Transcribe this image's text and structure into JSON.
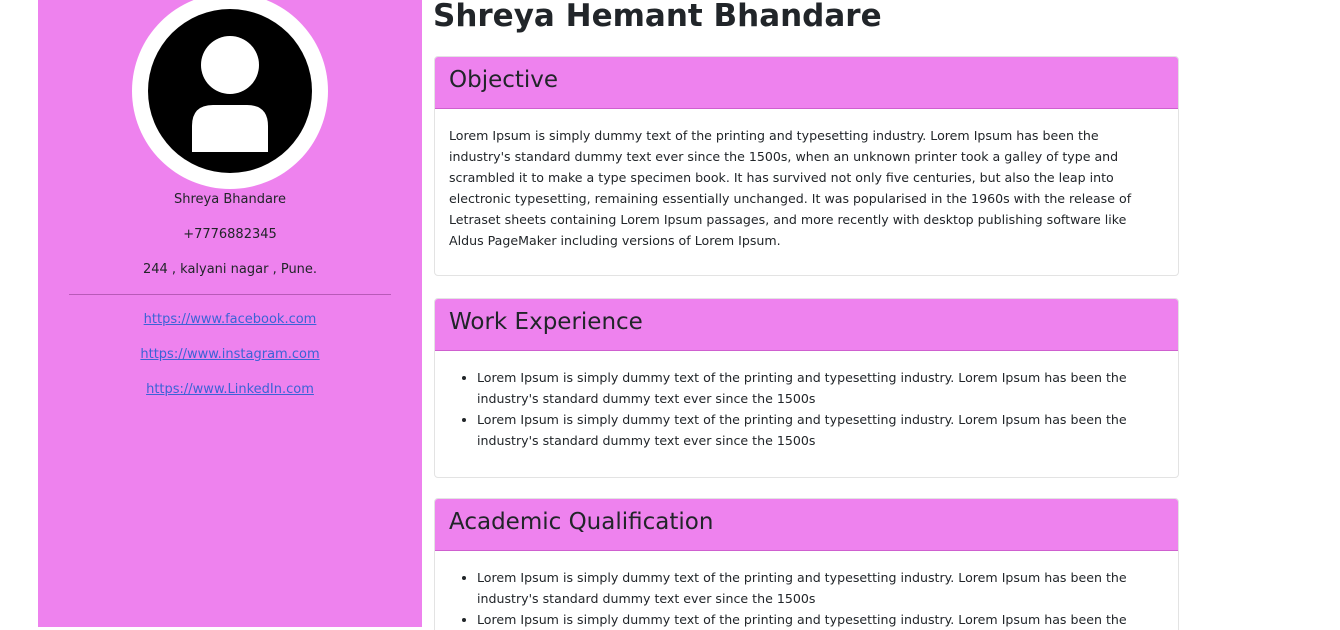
{
  "sidebar": {
    "name": "Shreya Bhandare",
    "phone": "+7776882345",
    "address": "244 , kalyani nagar , Pune.",
    "links": {
      "facebook": "https://www.facebook.com",
      "instagram": "https://www.instagram.com",
      "linkedin": "https://www.LinkedIn.com"
    }
  },
  "main": {
    "title": "Shreya Hemant Bhandare",
    "objective": {
      "heading": "Objective",
      "text": "Lorem Ipsum is simply dummy text of the printing and typesetting industry. Lorem Ipsum has been the industry's standard dummy text ever since the 1500s, when an unknown printer took a galley of type and scrambled it to make a type specimen book. It has survived not only five centuries, but also the leap into electronic typesetting, remaining essentially unchanged. It was popularised in the 1960s with the release of Letraset sheets containing Lorem Ipsum passages, and more recently with desktop publishing software like Aldus PageMaker including versions of Lorem Ipsum."
    },
    "work_experience": {
      "heading": "Work Experience",
      "items": [
        "Lorem Ipsum is simply dummy text of the printing and typesetting industry. Lorem Ipsum has been the industry's standard dummy text ever since the 1500s",
        "Lorem Ipsum is simply dummy text of the printing and typesetting industry. Lorem Ipsum has been the industry's standard dummy text ever since the 1500s"
      ]
    },
    "academic_qualification": {
      "heading": "Academic Qualification",
      "items": [
        "Lorem Ipsum is simply dummy text of the printing and typesetting industry. Lorem Ipsum has been the industry's standard dummy text ever since the 1500s",
        "Lorem Ipsum is simply dummy text of the printing and typesetting industry. Lorem Ipsum has been the"
      ]
    }
  },
  "colors": {
    "accent": "#ee82ee",
    "link": "#3b63d6",
    "text": "#212529"
  },
  "icons": {
    "avatar": "user-silhouette-icon"
  }
}
